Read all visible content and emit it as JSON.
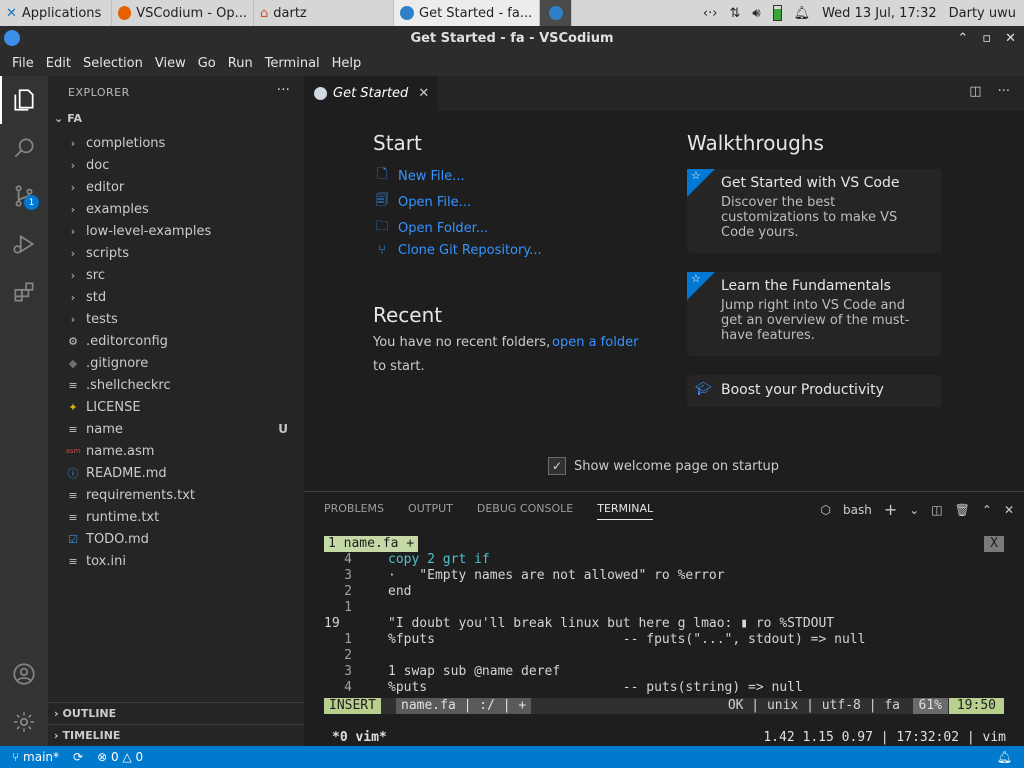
{
  "taskbar": {
    "tasks": [
      {
        "label": "Applications"
      },
      {
        "label": "VSCodium - Op..."
      },
      {
        "label": "dartz"
      },
      {
        "label": "Get Started - fa..."
      }
    ],
    "clock": "Wed 13 Jul, 17:32",
    "user": "Darty uwu"
  },
  "window": {
    "title": "Get Started - fa - VSCodium"
  },
  "menu": [
    "File",
    "Edit",
    "Selection",
    "View",
    "Go",
    "Run",
    "Terminal",
    "Help"
  ],
  "activity": {
    "scm_badge": "1"
  },
  "sidebar": {
    "header": "EXPLORER",
    "root": "FA",
    "folders": [
      "completions",
      "doc",
      "editor",
      "examples",
      "low-level-examples",
      "scripts",
      "src",
      "std",
      "tests"
    ],
    "files": [
      {
        "name": ".editorconfig",
        "icon": "gear"
      },
      {
        "name": ".gitignore",
        "icon": "diamond"
      },
      {
        "name": ".shellcheckrc",
        "icon": "lines"
      },
      {
        "name": "LICENSE",
        "icon": "person"
      },
      {
        "name": "name",
        "icon": "lines",
        "status": "U"
      },
      {
        "name": "name.asm",
        "icon": "asm"
      },
      {
        "name": "README.md",
        "icon": "info"
      },
      {
        "name": "requirements.txt",
        "icon": "lines"
      },
      {
        "name": "runtime.txt",
        "icon": "lines"
      },
      {
        "name": "TODO.md",
        "icon": "check"
      },
      {
        "name": "tox.ini",
        "icon": "lines"
      }
    ],
    "outline": "OUTLINE",
    "timeline": "TIMELINE"
  },
  "editor": {
    "tab": "Get Started"
  },
  "welcome": {
    "start_title": "Start",
    "start_links": [
      "New File...",
      "Open File...",
      "Open Folder...",
      "Clone Git Repository..."
    ],
    "recent_title": "Recent",
    "recent_text_1": "You have no recent folders,",
    "recent_link": "open a folder",
    "recent_text_2": "to start.",
    "walk_title": "Walkthroughs",
    "cards": [
      {
        "title": "Get Started with VS Code",
        "desc": "Discover the best customizations to make VS Code yours."
      },
      {
        "title": "Learn the Fundamentals",
        "desc": "Jump right into VS Code and get an overview of the must-have features."
      }
    ],
    "boost": "Boost your Productivity",
    "show_welcome": "Show welcome page on startup"
  },
  "panel": {
    "tabs": [
      "PROBLEMS",
      "OUTPUT",
      "DEBUG CONSOLE",
      "TERMINAL"
    ],
    "shell": "bash"
  },
  "terminal": {
    "buffer_tab": "1 name.fa +",
    "close_x": "X",
    "lines": [
      {
        "num": "4",
        "code": "copy 2 grt if"
      },
      {
        "num": "3",
        "code": "·   \"Empty names are not allowed\" ro %error"
      },
      {
        "num": "2",
        "code": "end"
      },
      {
        "num": "1",
        "code": ""
      },
      {
        "num": "19",
        "code": "\"I doubt you'll break linux but here g lmao: ▮ ro %STDOUT"
      },
      {
        "num": "1",
        "code": "%fputs                        -- fputs(\"...\", stdout) => null"
      },
      {
        "num": "2",
        "code": ""
      },
      {
        "num": "3",
        "code": "1 swap sub @name deref"
      },
      {
        "num": "4",
        "code": "%puts                         -- puts(string) => null"
      }
    ],
    "mode": "INSERT",
    "file_info": "name.fa | :/ | +",
    "file_meta": "OK | unix | utf-8 | fa",
    "percent": "61%",
    "position": "19:50",
    "tmux_left": "*0 vim*",
    "tmux_right": "1.42 1.15 0.97 | 17:32:02 | vim"
  },
  "statusbar": {
    "branch": "main*",
    "errors": "0",
    "warnings": "0"
  }
}
